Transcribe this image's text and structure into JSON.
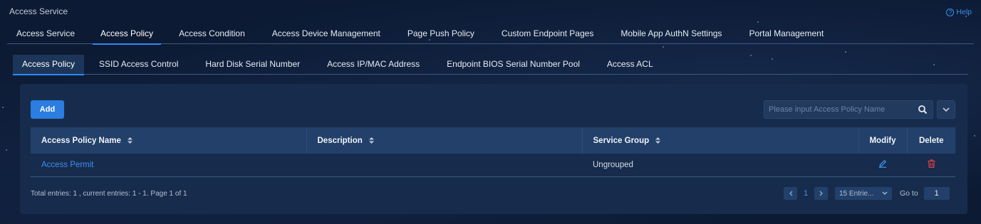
{
  "app": {
    "title": "Access Service",
    "help_label": "Help"
  },
  "main_tabs": [
    {
      "label": "Access Service",
      "active": false
    },
    {
      "label": "Access Policy",
      "active": true
    },
    {
      "label": "Access Condition",
      "active": false
    },
    {
      "label": "Access Device Management",
      "active": false
    },
    {
      "label": "Page Push Policy",
      "active": false
    },
    {
      "label": "Custom Endpoint Pages",
      "active": false
    },
    {
      "label": "Mobile App AuthN Settings",
      "active": false
    },
    {
      "label": "Portal Management",
      "active": false
    }
  ],
  "sub_tabs": [
    {
      "label": "Access Policy",
      "active": true
    },
    {
      "label": "SSID Access Control",
      "active": false
    },
    {
      "label": "Hard Disk Serial Number",
      "active": false
    },
    {
      "label": "Access IP/MAC Address",
      "active": false
    },
    {
      "label": "Endpoint BIOS Serial Number Pool",
      "active": false
    },
    {
      "label": "Access ACL",
      "active": false
    }
  ],
  "toolbar": {
    "add_label": "Add",
    "search_placeholder": "Please input Access Policy Name",
    "search_value": ""
  },
  "table": {
    "columns": {
      "name": "Access Policy Name",
      "description": "Description",
      "service_group": "Service Group",
      "modify": "Modify",
      "delete": "Delete"
    },
    "rows": [
      {
        "name": "Access Permit",
        "description": "",
        "service_group": "Ungrouped"
      }
    ]
  },
  "footer": {
    "info": "Total entries: 1 , current entries: 1 - 1. Page 1 of 1",
    "current_page": "1",
    "per_page": "15 Entrie...",
    "goto_label": "Go to",
    "goto_value": "1"
  },
  "colors": {
    "accent": "#2f8af5",
    "link": "#3d8ef0",
    "delete": "#e0404a",
    "panel": "#172c4c",
    "background": "#0c1a33"
  },
  "icons": {
    "help": "help-circle-icon",
    "search": "search-icon",
    "dropdown": "chevron-down-icon",
    "modify": "pencil-icon",
    "delete": "trash-icon",
    "sort": "sort-icon",
    "prev": "chevron-left-icon",
    "next": "chevron-right-icon"
  }
}
